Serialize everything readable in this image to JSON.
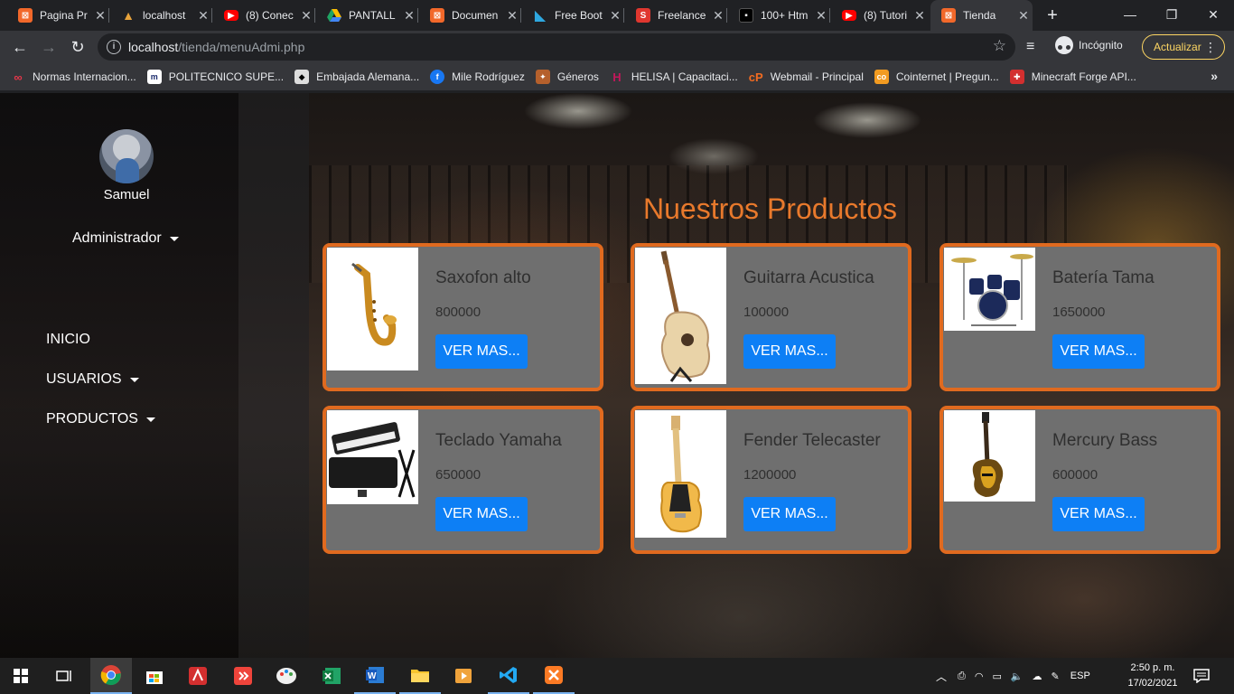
{
  "browser": {
    "tabs": [
      {
        "title": "Pagina Pr",
        "favicon_color": "#f2682a",
        "favicon_glyph": "xampp-icon"
      },
      {
        "title": "localhost",
        "favicon_color": "#e8a33b",
        "favicon_glyph": "folder-icon"
      },
      {
        "title": "(8) Conec",
        "favicon_color": "#ff0000",
        "favicon_glyph": "youtube-icon"
      },
      {
        "title": "PANTALL",
        "favicon_color": "#1fa463",
        "favicon_glyph": "drive-icon"
      },
      {
        "title": "Documen",
        "favicon_color": "#f2682a",
        "favicon_glyph": "xampp-icon"
      },
      {
        "title": "Free Boot",
        "favicon_color": "#2ea8e0",
        "favicon_glyph": "bootstrap-icon"
      },
      {
        "title": "Freelance",
        "favicon_color": "#e0372f",
        "favicon_glyph": "s-icon"
      },
      {
        "title": "100+ Htm",
        "favicon_color": "#222222",
        "favicon_glyph": "html-icon"
      },
      {
        "title": "(8) Tutori",
        "favicon_color": "#ff0000",
        "favicon_glyph": "youtube-icon"
      },
      {
        "title": "Tienda",
        "favicon_color": "#f2682a",
        "favicon_glyph": "xampp-icon"
      }
    ],
    "url_host": "localhost",
    "url_path": "/tienda/menuAdmi.php",
    "incognito_label": "Incógnito",
    "update_label": "Actualizar",
    "bookmarks": [
      {
        "label": "Normas Internacion...",
        "color": "#e8364a"
      },
      {
        "label": "POLITECNICO SUPE...",
        "color": "#ffffff"
      },
      {
        "label": "Embajada Alemana...",
        "color": "#dddddd"
      },
      {
        "label": "Mile Rodríguez",
        "color": "#1877f2"
      },
      {
        "label": "Géneros",
        "color": "#b5602c"
      },
      {
        "label": "HELISA | Capacitaci...",
        "color": "#c2185b"
      },
      {
        "label": "Webmail - Principal",
        "color": "#f26b21"
      },
      {
        "label": "Cointernet | Pregun...",
        "color": "#f29b21"
      },
      {
        "label": "Minecraft Forge API...",
        "color": "#d32f2f"
      }
    ]
  },
  "sidebar": {
    "user_name": "Samuel",
    "role": "Administrador",
    "nav": [
      "INICIO",
      "USUARIOS",
      "PRODUCTOS"
    ]
  },
  "main": {
    "title": "Nuestros Productos",
    "button_label": "VER MAS...",
    "products": [
      {
        "name": "Saxofon alto",
        "price": "800000",
        "image": "saxophone-image"
      },
      {
        "name": "Guitarra Acustica",
        "price": "100000",
        "image": "acoustic-guitar-image"
      },
      {
        "name": "Batería Tama",
        "price": "1650000",
        "image": "drum-kit-image"
      },
      {
        "name": "Teclado Yamaha",
        "price": "650000",
        "image": "keyboard-image"
      },
      {
        "name": "Fender Telecaster",
        "price": "1200000",
        "image": "electric-guitar-image"
      },
      {
        "name": "Mercury Bass",
        "price": "600000",
        "image": "bass-guitar-image"
      }
    ]
  },
  "taskbar": {
    "language": "ESP",
    "time": "2:50 p. m.",
    "date": "17/02/2021"
  },
  "colors": {
    "accent_orange": "#e06a1f",
    "title_orange": "#e8792c",
    "button_blue": "#0d7ff5",
    "card_bg": "#6f6f6f"
  }
}
